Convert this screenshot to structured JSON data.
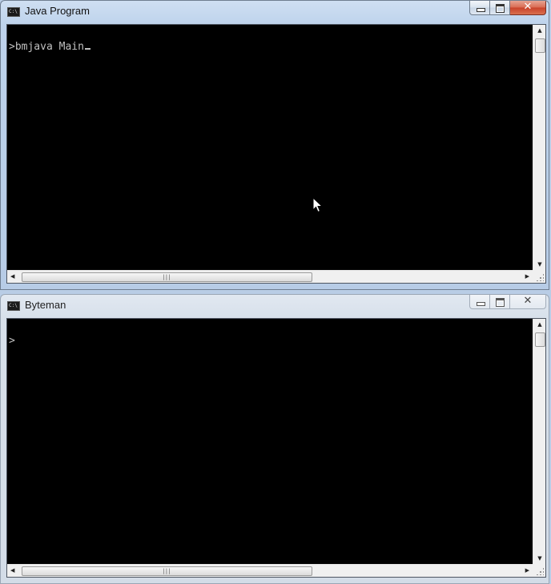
{
  "windows": [
    {
      "title": "Java Program",
      "icon": "console-icon",
      "icon_text": "C:\\",
      "active": true,
      "console_text": ">bmjava Main",
      "cursor_visible": true
    },
    {
      "title": "Byteman",
      "icon": "console-icon",
      "icon_text": "C:\\",
      "active": false,
      "console_text": ">",
      "cursor_visible": false
    }
  ],
  "controls": {
    "close_glyph": "✕"
  },
  "scrollbar": {
    "up_arrow": "▲",
    "down_arrow": "▼",
    "left_arrow": "◀",
    "right_arrow": "▶",
    "thumb_grip": "|||"
  },
  "colors": {
    "console_background": "#000000",
    "console_text": "#c0c0c0",
    "active_frame": "#bed3ec",
    "close_button_active": "#c8412a"
  }
}
